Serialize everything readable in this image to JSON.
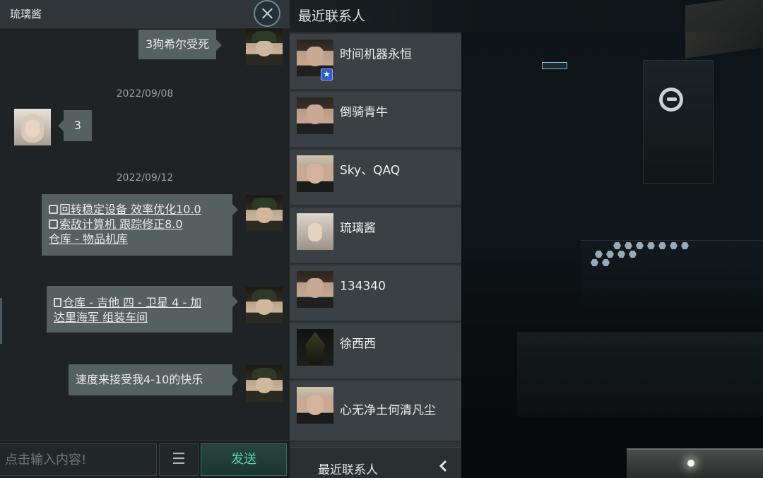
{
  "chat": {
    "title": "琉璃酱",
    "messages": [
      {
        "type": "text",
        "side": "mine",
        "text": "3狗希尔受死"
      },
      {
        "type": "date",
        "text": "2022/09/08"
      },
      {
        "type": "text",
        "side": "theirs",
        "text": "3"
      },
      {
        "type": "date",
        "text": "2022/09/12"
      },
      {
        "type": "links",
        "side": "mine",
        "lines": [
          "回转稳定设备 效率优化10.0",
          "索敌计算机 跟踪修正8.0",
          "仓库 - 物品机库"
        ]
      },
      {
        "type": "links",
        "side": "mine",
        "lines": [
          "仓库 - 吉他 四 - 卫星 4 - 加",
          "达里海军 组装车间"
        ]
      },
      {
        "type": "text",
        "side": "mine",
        "text": "速度来接受我4-10的快乐"
      }
    ],
    "input_placeholder": "点击输入内容!",
    "menu_icon": "☰",
    "send_label": "发送"
  },
  "contacts": {
    "title": "最近联系人",
    "items": [
      {
        "name": "时间机器永恒",
        "avatar": "man",
        "badge": "★"
      },
      {
        "name": "倒骑青牛",
        "avatar": "man"
      },
      {
        "name": "Sky、QAQ",
        "avatar": "blond"
      },
      {
        "name": "琉璃酱",
        "avatar": "girl"
      },
      {
        "name": "134340",
        "avatar": "man"
      },
      {
        "name": "徐西西",
        "avatar": "dark"
      },
      {
        "name": "心无净土何清凡尘",
        "avatar": "blond"
      }
    ],
    "footer_label": "最近联系人",
    "footer_icon": "chevron-left-icon"
  },
  "colors": {
    "panel": "#1f2325",
    "bubble": "#56605f",
    "send_text": "#5fd2a8",
    "badge": "#2b5cc8"
  }
}
